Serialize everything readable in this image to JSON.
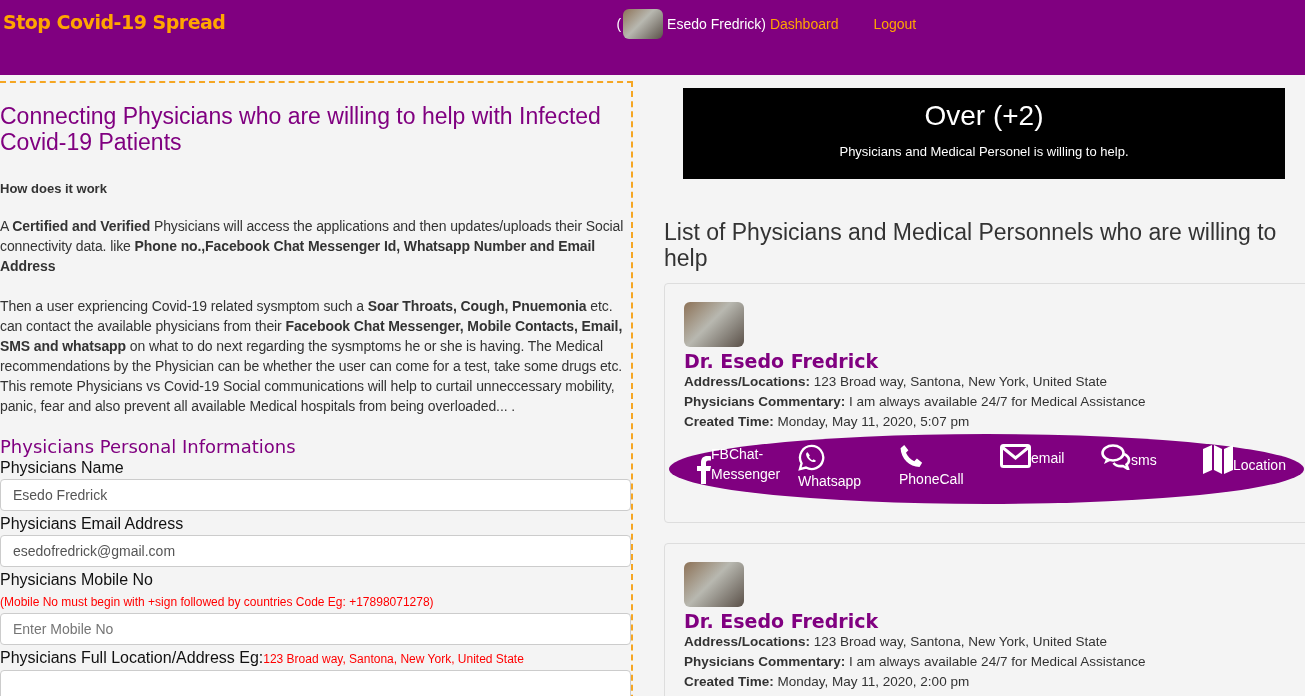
{
  "header": {
    "brand": "Stop Covid-19 Spread",
    "user_open": "(",
    "user_name": "Esedo Fredrick)",
    "links": [
      "Dashboard",
      "Logout"
    ]
  },
  "intro": {
    "title": "Connecting Physicians who are willing to help with Infected Covid-19 Patients",
    "subtitle": "How does it work",
    "paragraphs": [
      "A **Certified and Verified** Physicians will access the applications and then updates/uploads their Social connectivity data. like **Phone no.,Facebook Chat Messenger Id, Whatsapp Number and Email Address**",
      "Then a user expriencing Covid-19 related sysmptom such a **Soar Throats, Cough, Pnuemonia** etc. can contact the available physicians from their **Facebook Chat Messenger, Mobile Contacts, Email, SMS and whatsapp** on what to do next regarding the sysmptoms he or she is having. The Medical recommendations by the Physician can be whether the user can come for a test, take some drugs etc. This remote Physicians vs Covid-19 Social communications will help to curtail unneccessary mobility, panic, fear and also prevent all available Medical hospitals from being overloaded... ."
    ]
  },
  "form": {
    "title": "Physicians Personal Informations",
    "fields": [
      {
        "label": "Physicians Name",
        "value": "Esedo Fredrick"
      },
      {
        "label": "Physicians Email Address",
        "value": "esedofredrick@gmail.com"
      },
      {
        "label": "Physicians Mobile No",
        "note": "(Mobile No must begin with +sign followed by countries Code Eg: +17898071278)",
        "placeholder": "Enter Mobile No"
      },
      {
        "label": "Physicians Full Location/Address Eg:",
        "example": "123 Broad way, Santona, New York, United State"
      }
    ]
  },
  "banner": {
    "count": "Over (+2)",
    "text": "Physicians and Medical Personel is willing to help."
  },
  "list": {
    "title": "List of Physicians and Medical Personnels who are willing to help",
    "physicians": [
      {
        "name": "Dr. Esedo Fredrick",
        "details": [
          {
            "label": "Address/Locations:",
            "value": "123 Broad way, Santona, New York, United State"
          },
          {
            "label": "Physicians Commentary:",
            "value": "I am always available 24/7 for Medical Assistance"
          },
          {
            "label": "Created Time:",
            "value": "Monday, May 11, 2020, 5:07 pm"
          }
        ],
        "contacts": [
          {
            "kind": "facebook",
            "label": "FBChat-Messenger"
          },
          {
            "kind": "whatsapp",
            "label": "Whatsapp"
          },
          {
            "kind": "phone",
            "label": "PhoneCall"
          },
          {
            "kind": "email",
            "label": "email"
          },
          {
            "kind": "sms",
            "label": "sms"
          },
          {
            "kind": "location",
            "label": "Location"
          }
        ]
      },
      {
        "name": "Dr. Esedo Fredrick",
        "details": [
          {
            "label": "Address/Locations:",
            "value": "123 Broad way, Santona, New York, United State"
          },
          {
            "label": "Physicians Commentary:",
            "value": "I am always available 24/7 for Medical Assistance"
          },
          {
            "label": "Created Time:",
            "value": "Monday, May 11, 2020, 2:00 pm"
          }
        ]
      }
    ]
  }
}
